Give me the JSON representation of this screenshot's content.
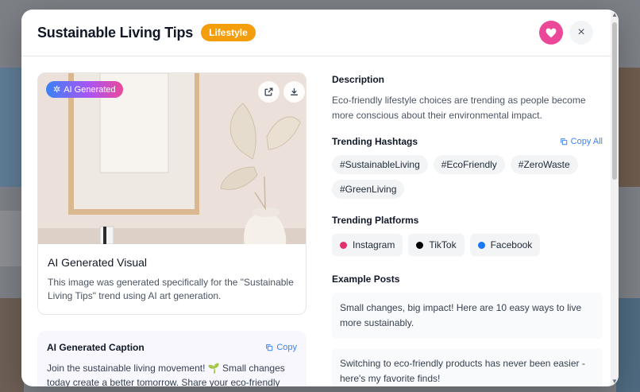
{
  "modal": {
    "title": "Sustainable Living Tips",
    "category_badge": "Lifestyle",
    "actions": {
      "favorite_icon": "heart-icon",
      "close_label": "×"
    }
  },
  "visual": {
    "ai_badge": "AI Generated",
    "title": "AI Generated Visual",
    "description": "This image was generated specifically for the \"Sustainable Living Tips\" trend using AI art generation."
  },
  "caption": {
    "title": "AI Generated Caption",
    "copy_label": "Copy",
    "text": "Join the sustainable living movement! 🌱 Small changes today create a better tomorrow. Share your eco-friendly"
  },
  "description": {
    "label": "Description",
    "text": "Eco-friendly lifestyle choices are trending as people become more conscious about their environmental impact."
  },
  "hashtags": {
    "label": "Trending Hashtags",
    "copy_all_label": "Copy All",
    "items": [
      "#SustainableLiving",
      "#EcoFriendly",
      "#ZeroWaste",
      "#GreenLiving"
    ]
  },
  "platforms": {
    "label": "Trending Platforms",
    "items": [
      {
        "name": "Instagram",
        "color": "#e1306c"
      },
      {
        "name": "TikTok",
        "color": "#000000"
      },
      {
        "name": "Facebook",
        "color": "#1877f2"
      }
    ]
  },
  "example_posts": {
    "label": "Example Posts",
    "items": [
      "Small changes, big impact! Here are 10 easy ways to live more sustainably.",
      "Switching to eco-friendly products has never been easier - here's my favorite finds!"
    ]
  },
  "colors": {
    "accent": "#f59e0b",
    "favorite": "#ec4899",
    "link": "#3b82f6"
  }
}
